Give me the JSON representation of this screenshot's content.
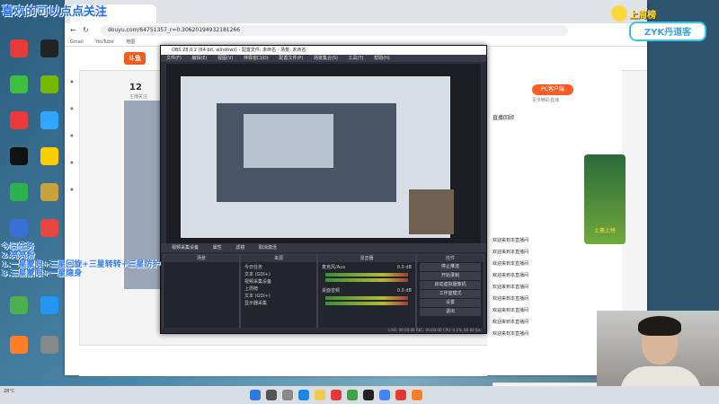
{
  "overlay": {
    "title": "喜欢的可以点点关注",
    "left_lines": [
      "今日任务",
      "2.亮亮粉",
      "1.一星蒙眼+三星回旋+三星转转+三星防护",
      "3.三星蒙眼+一星隐身"
    ]
  },
  "leaderboard": {
    "label": "上周榜",
    "name": "ZYK丹道客"
  },
  "browser": {
    "tab_title": "douyu.com",
    "url": "douyu.com/64751357_r=0.30620194932181266",
    "bookmarks": [
      "Gmail",
      "YouTube",
      "地图"
    ]
  },
  "site": {
    "follow_count": "12",
    "follow_label": "主播关注",
    "pc_button": "PC客户端",
    "pc_sub": "更多精彩直播",
    "tab_line": "直播回顾",
    "chat_lines": [
      "欢迎来到本直播间",
      "欢迎来到本直播间",
      "欢迎来到本直播间",
      "欢迎来到本直播间",
      "欢迎来到本直播间",
      "欢迎来到本直播间",
      "欢迎来到本直播间",
      "欢迎来到本直播间",
      "欢迎来到本直播间"
    ],
    "send_label": "发送",
    "side_ad": "土豪上榜"
  },
  "obs": {
    "title": "OBS 28.0.2 (64-bit, windows) - 配置文件: 未命名 - 场景: 未命名",
    "menu": [
      "文件(F)",
      "编辑(E)",
      "视图(V)",
      "停靠窗口(D)",
      "配置文件(P)",
      "场景集合(S)",
      "工具(T)",
      "帮助(H)"
    ],
    "src_bar": [
      "视频采集设备",
      "属性",
      "滤镜",
      "取消激活"
    ],
    "panels": {
      "scenes": "场景",
      "sources": "来源",
      "mixer": "混音器",
      "controls": "控件"
    },
    "sources": [
      "今日任务",
      "文本 (GDI+)",
      "视频采集设备",
      "上周榜",
      "文本 (GDI+)",
      "显示器采集"
    ],
    "mixer": [
      {
        "name": "麦克风/Aux",
        "level": "0.0 dB"
      },
      {
        "name": "桌面音频",
        "level": "0.0 dB"
      }
    ],
    "controls": [
      "停止推流",
      "开始录制",
      "启动虚拟摄像机",
      "工作室模式",
      "设置",
      "退出"
    ],
    "status": "LIVE: 00:00:00   REC: 00:00:00   CPU: 0.1%, 60.00 fps"
  },
  "taskbar": {
    "weather": "28°C"
  }
}
